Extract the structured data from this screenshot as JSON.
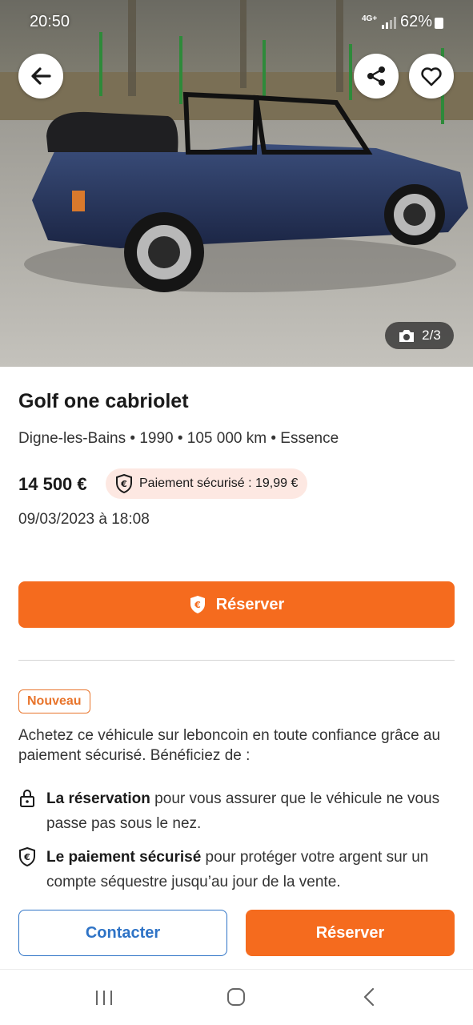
{
  "status_bar": {
    "time": "20:50",
    "network": "4G+",
    "battery": "62%"
  },
  "hero": {
    "photo_counter": "2/3",
    "icons": {
      "back": "arrow-left-icon",
      "share": "share-icon",
      "favorite": "heart-icon",
      "camera": "camera-icon"
    }
  },
  "listing": {
    "title": "Golf one cabriolet",
    "subtitle": "Digne-les-Bains • 1990 • 105 000 km • Essence",
    "price": "14 500 €",
    "secure_payment_badge": "Paiement sécurisé : 19,99 €",
    "date": "09/03/2023 à 18:08"
  },
  "reserve_button_label": "Réserver",
  "secure_info": {
    "tag": "Nouveau",
    "intro": "Achetez ce véhicule sur leboncoin en toute confiance grâce au paiement sécurisé. Bénéficiez de :",
    "features": [
      {
        "icon": "lock-icon",
        "bold": "La réservation",
        "text": " pour vous assurer que le véhicule ne vous passe pas sous le nez."
      },
      {
        "icon": "shield-euro-icon",
        "bold": "Le paiement sécurisé",
        "text": " pour protéger votre argent sur un compte séquestre jusqu’au jour de la vente."
      }
    ]
  },
  "bottom_actions": {
    "contact_label": "Contacter",
    "reserve_label": "Réserver"
  },
  "colors": {
    "accent_orange": "#f56b1e",
    "link_blue": "#2e73c6",
    "badge_bg": "#fde8e2"
  }
}
